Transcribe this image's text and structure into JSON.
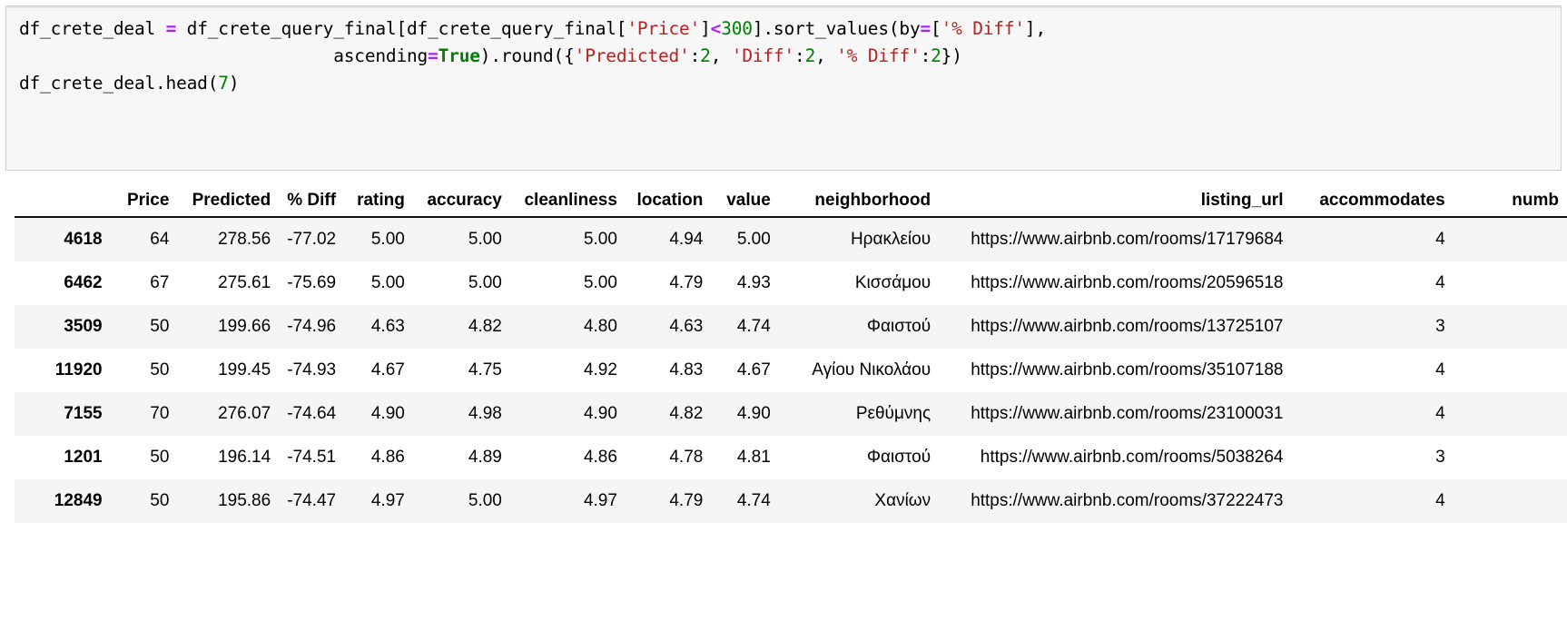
{
  "code_cell": {
    "lines": [
      [
        {
          "t": "df_crete_deal ",
          "c": "plain"
        },
        {
          "t": "=",
          "c": "op"
        },
        {
          "t": " df_crete_query_final[df_crete_query_final[",
          "c": "plain"
        },
        {
          "t": "'Price'",
          "c": "str"
        },
        {
          "t": "]",
          "c": "plain"
        },
        {
          "t": "<",
          "c": "op"
        },
        {
          "t": "300",
          "c": "num"
        },
        {
          "t": "].sort_values(by",
          "c": "plain"
        },
        {
          "t": "=",
          "c": "op"
        },
        {
          "t": "[",
          "c": "plain"
        },
        {
          "t": "'% Diff'",
          "c": "str"
        },
        {
          "t": "],",
          "c": "plain"
        }
      ],
      [
        {
          "t": "                              ascending",
          "c": "plain"
        },
        {
          "t": "=",
          "c": "op"
        },
        {
          "t": "True",
          "c": "kw"
        },
        {
          "t": ").round({",
          "c": "plain"
        },
        {
          "t": "'Predicted'",
          "c": "str"
        },
        {
          "t": ":",
          "c": "plain"
        },
        {
          "t": "2",
          "c": "num"
        },
        {
          "t": ", ",
          "c": "plain"
        },
        {
          "t": "'Diff'",
          "c": "str"
        },
        {
          "t": ":",
          "c": "plain"
        },
        {
          "t": "2",
          "c": "num"
        },
        {
          "t": ", ",
          "c": "plain"
        },
        {
          "t": "'% Diff'",
          "c": "str"
        },
        {
          "t": ":",
          "c": "plain"
        },
        {
          "t": "2",
          "c": "num"
        },
        {
          "t": "})",
          "c": "plain"
        }
      ],
      [
        {
          "t": "df_crete_deal.head(",
          "c": "plain"
        },
        {
          "t": "7",
          "c": "num"
        },
        {
          "t": ")",
          "c": "plain"
        }
      ]
    ]
  },
  "table": {
    "index_header": "",
    "columns": [
      {
        "key": "price",
        "label": "Price",
        "cls": "c-price"
      },
      {
        "key": "predicted",
        "label": "Predicted",
        "cls": "c-pred"
      },
      {
        "key": "pct_diff",
        "label": "% Diff",
        "cls": "c-pdiff"
      },
      {
        "key": "rating",
        "label": "rating",
        "cls": "c-rate"
      },
      {
        "key": "accuracy",
        "label": "accuracy",
        "cls": "c-acc"
      },
      {
        "key": "cleanliness",
        "label": "cleanliness",
        "cls": "c-clean"
      },
      {
        "key": "location",
        "label": "location",
        "cls": "c-loc"
      },
      {
        "key": "value",
        "label": "value",
        "cls": "c-val"
      },
      {
        "key": "neighborhood",
        "label": "neighborhood",
        "cls": "c-nbhd"
      },
      {
        "key": "listing_url",
        "label": "listing_url",
        "cls": "c-url"
      },
      {
        "key": "accommodates",
        "label": "accommodates",
        "cls": "c-accom"
      },
      {
        "key": "number",
        "label": "numb",
        "cls": "c-numb"
      }
    ],
    "rows": [
      {
        "index": "4618",
        "price": "64",
        "predicted": "278.56",
        "pct_diff": "-77.02",
        "rating": "5.00",
        "accuracy": "5.00",
        "cleanliness": "5.00",
        "location": "4.94",
        "value": "5.00",
        "neighborhood": "Ηρακλείου",
        "listing_url": "https://www.airbnb.com/rooms/17179684",
        "accommodates": "4",
        "number": ""
      },
      {
        "index": "6462",
        "price": "67",
        "predicted": "275.61",
        "pct_diff": "-75.69",
        "rating": "5.00",
        "accuracy": "5.00",
        "cleanliness": "5.00",
        "location": "4.79",
        "value": "4.93",
        "neighborhood": "Κισσάμου",
        "listing_url": "https://www.airbnb.com/rooms/20596518",
        "accommodates": "4",
        "number": ""
      },
      {
        "index": "3509",
        "price": "50",
        "predicted": "199.66",
        "pct_diff": "-74.96",
        "rating": "4.63",
        "accuracy": "4.82",
        "cleanliness": "4.80",
        "location": "4.63",
        "value": "4.74",
        "neighborhood": "Φαιστού",
        "listing_url": "https://www.airbnb.com/rooms/13725107",
        "accommodates": "3",
        "number": ""
      },
      {
        "index": "11920",
        "price": "50",
        "predicted": "199.45",
        "pct_diff": "-74.93",
        "rating": "4.67",
        "accuracy": "4.75",
        "cleanliness": "4.92",
        "location": "4.83",
        "value": "4.67",
        "neighborhood": "Αγίου Νικολάου",
        "listing_url": "https://www.airbnb.com/rooms/35107188",
        "accommodates": "4",
        "number": ""
      },
      {
        "index": "7155",
        "price": "70",
        "predicted": "276.07",
        "pct_diff": "-74.64",
        "rating": "4.90",
        "accuracy": "4.98",
        "cleanliness": "4.90",
        "location": "4.82",
        "value": "4.90",
        "neighborhood": "Ρεθύμνης",
        "listing_url": "https://www.airbnb.com/rooms/23100031",
        "accommodates": "4",
        "number": ""
      },
      {
        "index": "1201",
        "price": "50",
        "predicted": "196.14",
        "pct_diff": "-74.51",
        "rating": "4.86",
        "accuracy": "4.89",
        "cleanliness": "4.86",
        "location": "4.78",
        "value": "4.81",
        "neighborhood": "Φαιστού",
        "listing_url": "https://www.airbnb.com/rooms/5038264",
        "accommodates": "3",
        "number": ""
      },
      {
        "index": "12849",
        "price": "50",
        "predicted": "195.86",
        "pct_diff": "-74.47",
        "rating": "4.97",
        "accuracy": "5.00",
        "cleanliness": "4.97",
        "location": "4.79",
        "value": "4.74",
        "neighborhood": "Χανίων",
        "listing_url": "https://www.airbnb.com/rooms/37222473",
        "accommodates": "4",
        "number": ""
      }
    ]
  }
}
